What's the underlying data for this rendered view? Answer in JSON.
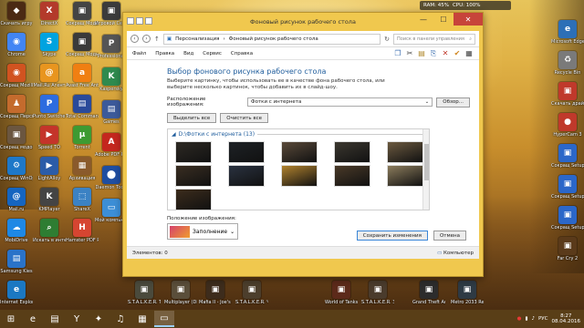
{
  "desktop": {
    "icons_left": [
      {
        "label": "Cкачать игру",
        "color": "#4b2a14",
        "glyph": "◆"
      },
      {
        "label": "Chrome",
        "color": "#4285f4",
        "glyph": "◉"
      },
      {
        "label": "Сокращ Mozilla",
        "color": "#d15320",
        "glyph": "◉"
      },
      {
        "label": "Сокращ Персоната",
        "color": "#c46b2d",
        "glyph": "♟"
      },
      {
        "label": "Сокращ модов",
        "color": "#6b5640",
        "glyph": "▣"
      },
      {
        "label": "Сокращ WinOption",
        "color": "#1e78c8",
        "glyph": "⚙"
      },
      {
        "label": "Mail.ru",
        "color": "#1565c0",
        "glyph": "@"
      },
      {
        "label": "MobiDrive",
        "color": "#1e88e5",
        "glyph": "☁"
      },
      {
        "label": "Samsung Kies",
        "color": "#2a73c9",
        "glyph": "▤"
      },
      {
        "label": "Internet Explorer",
        "color": "#1b78c2",
        "glyph": "e"
      }
    ],
    "icons_col2": [
      {
        "label": "DirectX",
        "color": "#b33a2b",
        "glyph": "X"
      },
      {
        "label": "Skype",
        "color": "#00a3e0",
        "glyph": "S"
      },
      {
        "label": "Mail.Ru Агент",
        "color": "#e8951f",
        "glyph": "@"
      },
      {
        "label": "Punto Switcher",
        "color": "#2d6cdf",
        "glyph": "P"
      },
      {
        "label": "Speed TO",
        "color": "#c4342a",
        "glyph": "▶"
      },
      {
        "label": "LightAlloy",
        "color": "#2b5ca8",
        "glyph": "▶"
      },
      {
        "label": "KMPlayer",
        "color": "#444444",
        "glyph": "K"
      },
      {
        "label": "Искать в интернете",
        "color": "#2e7d32",
        "glyph": "⌕"
      }
    ],
    "icons_col3": [
      {
        "label": "Сокращ Моды",
        "color": "#444444",
        "glyph": "▣"
      },
      {
        "label": "Сокращ Моды Sum",
        "color": "#3a3a3a",
        "glyph": "▣"
      },
      {
        "label": "Avast Free Antivirus",
        "color": "#f07f12",
        "glyph": "a"
      },
      {
        "label": "Total Commander",
        "color": "#2a4a9a",
        "glyph": "▤"
      },
      {
        "label": "Torrent",
        "color": "#3d9a32",
        "glyph": "μ"
      },
      {
        "label": "Архивация",
        "color": "#8a5a2b",
        "glyph": "▦"
      },
      {
        "label": "ShareX",
        "color": "#3b82c4",
        "glyph": "⬚"
      },
      {
        "label": "Hamster PDF Reader",
        "color": "#d64531",
        "glyph": "H"
      }
    ],
    "icons_col4": [
      {
        "label": "Игровой Сервис",
        "color": "#3b3b3b",
        "glyph": "▣"
      },
      {
        "label": "Professional",
        "color": "#555555",
        "glyph": "P"
      },
      {
        "label": "Kaspersky",
        "color": "#2f8a4e",
        "glyph": "K"
      },
      {
        "label": "Games",
        "color": "#3c5a9a",
        "glyph": "▤"
      },
      {
        "label": "Adobe PDF Reader",
        "color": "#c4271e",
        "glyph": "A"
      },
      {
        "label": "Daemon Tools",
        "color": "#1f4ea1",
        "glyph": "⬤"
      },
      {
        "label": "Мой компьютер",
        "color": "#3c8ed6",
        "glyph": "▭"
      }
    ],
    "icons_bottom": [
      {
        "label": "S.T.A.L.K.E.R. Тень Чернобыля",
        "color": "#4a4a3c",
        "glyph": "▣"
      },
      {
        "label": "Multiplayer (DirectX)",
        "color": "#5a4e3a",
        "glyph": "▣"
      },
      {
        "label": "Mafia II - Joe's Adventure",
        "color": "#3d2c1c",
        "glyph": "▣"
      },
      {
        "label": "S.T.A.L.K.E.R. Чистое небо",
        "color": "#4c3e2c",
        "glyph": "▣"
      },
      {
        "label": "World of Tanks",
        "color": "#5c2a1a",
        "glyph": "▣"
      },
      {
        "label": "S.T.A.L.K.E.R. Зов Припяти",
        "color": "#4a3b2c",
        "glyph": "▣"
      },
      {
        "label": "Grand Theft Auto San Andreas",
        "color": "#2c2c2c",
        "glyph": "▣"
      },
      {
        "label": "Metro 2033 Redux",
        "color": "#2e3a44",
        "glyph": "▣"
      }
    ],
    "icons_right": [
      {
        "label": "Microsoft Edge",
        "color": "#2c6fb7",
        "glyph": "e"
      },
      {
        "label": "Recycle Bin",
        "color": "#7a7a7a",
        "glyph": "♻"
      },
      {
        "label": "Cкачать драйвер",
        "color": "#c0392b",
        "glyph": "▣"
      },
      {
        "label": "HyperCam 3",
        "color": "#c0392b",
        "glyph": "●"
      },
      {
        "label": "Сокращ Setup",
        "color": "#2b67c9",
        "glyph": "▣"
      },
      {
        "label": "Сокращ Setup 2",
        "color": "#2b67c9",
        "glyph": "▣"
      },
      {
        "label": "Сокращ Setup 3",
        "color": "#2b67c9",
        "glyph": "▣"
      },
      {
        "label": "Far Cry 2",
        "color": "#5a3a1a",
        "glyph": "▣"
      }
    ]
  },
  "gadget": {
    "ram": "RAM: 45%",
    "cpu": "CPU: 100%"
  },
  "window": {
    "title": "Фоновый рисунок рабочего стола",
    "controls": {
      "minimize": "—",
      "maximize": "☐",
      "close": "✕"
    },
    "breadcrumb": [
      "Персонализация",
      "Фоновый рисунок рабочего стола"
    ],
    "search_placeholder": "Поиск в панели управления",
    "menu": [
      "Файл",
      "Правка",
      "Вид",
      "Сервис",
      "Справка"
    ],
    "heading": "Выбор фонового рисунка рабочего стола",
    "description": "Выберите картинку, чтобы использовать ее в качестве фона рабочего стола, или выберите несколько картинок, чтобы добавить их в слайд-шоу.",
    "location_label": "Расположение изображения:",
    "location_value": "Фотки с интернета",
    "browse_button": "Обзор...",
    "select_all_button": "Выделить все",
    "clear_all_button": "Очистить все",
    "gallery_header": "D:\\Фотки с интернета (13)",
    "thumbs_colors": [
      "#2e2a24",
      "#1e2226",
      "#5a4a3a",
      "#3c3830",
      "#6c5a40",
      "#2a1e18",
      "#3a2e22",
      "#2a3240",
      "#b0822e",
      "#4a3a28",
      "#8c7c5c",
      "#2c2a26",
      "#3c2c1c"
    ],
    "position_label": "Положение изображения:",
    "position_value": "Заполнение",
    "save_button": "Сохранить изменения",
    "cancel_button": "Отмена",
    "status_left": "Элементов: 0",
    "status_right": "Компьютер"
  },
  "taskbar": {
    "buttons": [
      {
        "name": "start",
        "glyph": "⊞"
      },
      {
        "name": "ie",
        "glyph": "e"
      },
      {
        "name": "explorer",
        "glyph": "▤"
      },
      {
        "name": "yandex",
        "glyph": "Y"
      },
      {
        "name": "tanks",
        "glyph": "✦"
      },
      {
        "name": "media",
        "glyph": "♫"
      },
      {
        "name": "store",
        "glyph": "▦"
      },
      {
        "name": "window",
        "glyph": "▭"
      }
    ],
    "lang": "РУС",
    "time": "8:27",
    "date": "08.04.2016"
  }
}
